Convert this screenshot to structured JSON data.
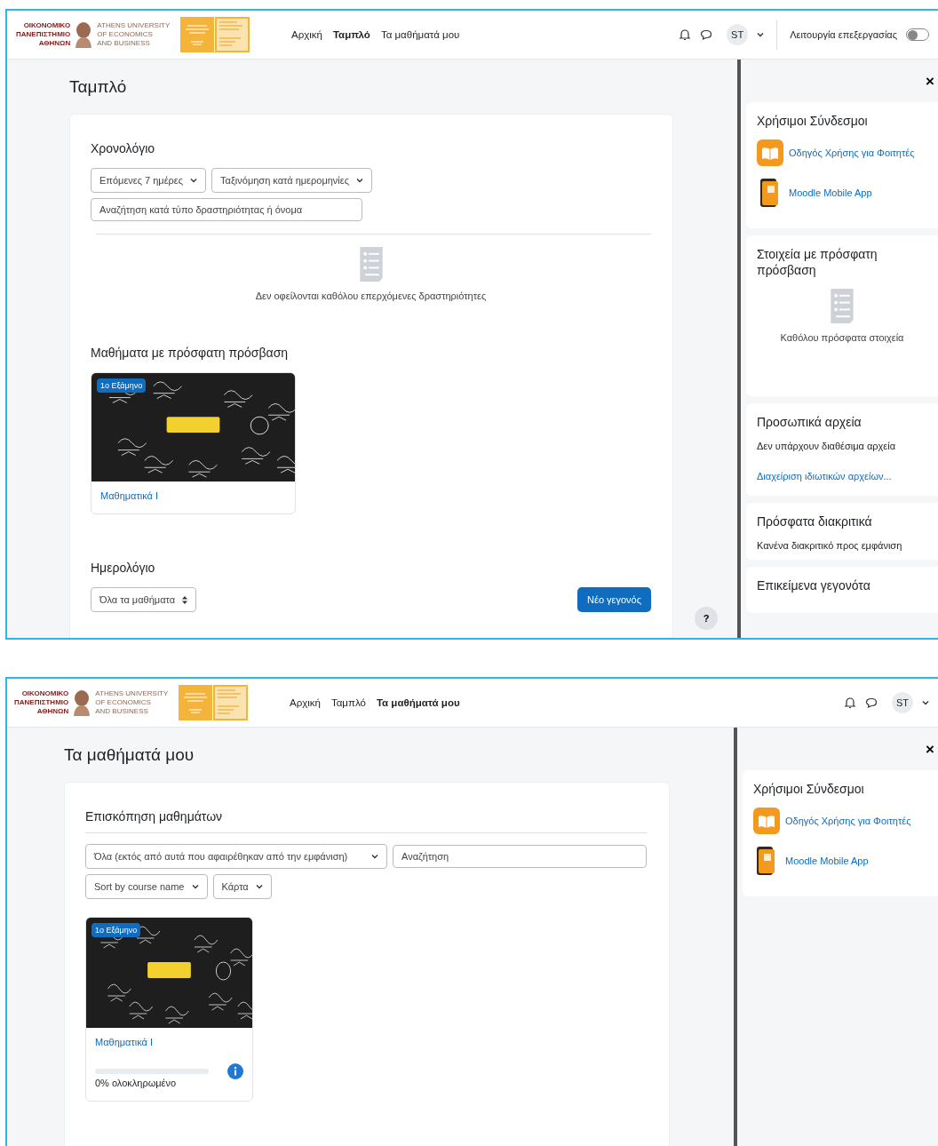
{
  "screens": [
    {
      "navbar": {
        "logo_greek": [
          "ΟΙΚΟΝΟΜΙΚΟ",
          "ΠΑΝΕΠΙΣΤΗΜΙΟ",
          "ΑΘΗΝΩΝ"
        ],
        "logo_english": [
          "ATHENS UNIVERSITY",
          "OF ECONOMICS",
          "AND BUSINESS"
        ],
        "nav": [
          {
            "label": "Αρχική",
            "selected": false
          },
          {
            "label": "Ταμπλό",
            "selected": true
          },
          {
            "label": "Τα μαθήματά μου",
            "selected": false
          }
        ],
        "avatar": "ST",
        "edit_mode": {
          "label": "Λειτουργία επεξεργασίας",
          "on": false
        }
      },
      "page_title": "Ταμπλό",
      "main_blocks": [
        {
          "kind": "timeline",
          "title": "Χρονολόγιο",
          "filters": [
            "Επόμενες 7 ημέρες",
            "Ταξινόμηση κατά ημερομηνίες"
          ],
          "search_placeholder": "Αναζήτηση κατά τύπο δραστηριότητας ή όνομα",
          "empty": "Δεν οφείλονται καθόλου επερχόμενες δραστηριότητες"
        },
        {
          "kind": "courses",
          "title": "Μαθήματα με πρόσφατη πρόσβαση",
          "courses": [
            {
              "tag": "1ο Εξάμηνο",
              "name": "Μαθηματικά Ι"
            }
          ]
        },
        {
          "kind": "calendar",
          "title": "Ημερολόγιο",
          "select": "Όλα τα μαθήματα",
          "button": "Νέο γεγονός"
        }
      ],
      "help": "?",
      "drawer": {
        "close": "×",
        "blocks": [
          {
            "kind": "links",
            "title": "Χρήσιμοι Σύνδεσμοι",
            "links": [
              {
                "label": "Οδηγός Χρήσης για Φοιτητές",
                "kind": "guide"
              },
              {
                "label": "Moodle Mobile App",
                "kind": "mobile"
              }
            ]
          },
          {
            "kind": "empty",
            "title": "Στοιχεία με πρόσφατη πρόσβαση",
            "text": "Καθόλου πρόσφατα στοιχεία"
          },
          {
            "kind": "files",
            "title": "Προσωπικά αρχεία",
            "text": "Δεν υπάρχουν διαθέσιμα αρχεία",
            "link": "Διαχείριση ιδιωτικών αρχείων..."
          },
          {
            "kind": "text",
            "title": "Πρόσφατα διακριτικά",
            "text": "Κανένα διακριτικό προς εμφάνιση"
          },
          {
            "kind": "text",
            "title": "Επικείμενα γεγονότα"
          }
        ]
      }
    },
    {
      "navbar": {
        "logo_greek": [
          "ΟΙΚΟΝΟΜΙΚΟ",
          "ΠΑΝΕΠΙΣΤΗΜΙΟ",
          "ΑΘΗΝΩΝ"
        ],
        "logo_english": [
          "ATHENS UNIVERSITY",
          "OF ECONOMICS",
          "AND BUSINESS"
        ],
        "nav": [
          {
            "label": "Αρχική",
            "selected": false
          },
          {
            "label": "Ταμπλό",
            "selected": false
          },
          {
            "label": "Τα μαθήματά μου",
            "selected": true
          }
        ],
        "avatar": "ST"
      },
      "page_title": "Τα μαθήματά μου",
      "main_blocks": [
        {
          "kind": "overview",
          "title": "Επισκόπηση μαθημάτων",
          "filters": [
            "Όλα (εκτός από αυτά που αφαιρέθηκαν από την εμφάνιση)"
          ],
          "search_placeholder": "Αναζήτηση",
          "sorts": [
            "Sort by course name",
            "Κάρτα"
          ],
          "courses": [
            {
              "tag": "1ο Εξάμηνο",
              "name": "Μαθηματικά Ι",
              "progress": "0% ολοκληρωμένο",
              "level": 0
            }
          ]
        }
      ],
      "drawer": {
        "close": "×",
        "blocks": [
          {
            "kind": "links",
            "title": "Χρήσιμοι Σύνδεσμοι",
            "links": [
              {
                "label": "Οδηγός Χρήσης για Φοιτητές",
                "kind": "guide"
              },
              {
                "label": "Moodle Mobile App",
                "kind": "mobile"
              }
            ]
          }
        ]
      }
    }
  ]
}
